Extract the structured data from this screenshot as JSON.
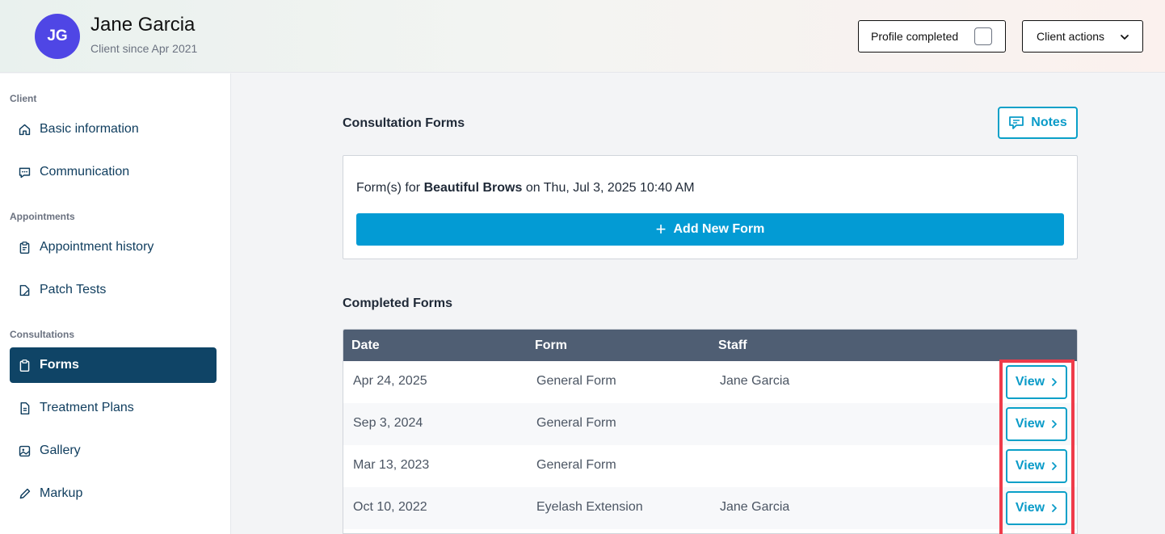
{
  "header": {
    "initials": "JG",
    "name": "Jane Garcia",
    "since": "Client since Apr 2021",
    "profile_completed_label": "Profile completed",
    "client_actions_label": "Client actions"
  },
  "sidebar": {
    "sections": [
      {
        "title": "Client",
        "items": [
          {
            "label": "Basic information",
            "icon": "home-icon"
          },
          {
            "label": "Communication",
            "icon": "chat-icon"
          }
        ]
      },
      {
        "title": "Appointments",
        "items": [
          {
            "label": "Appointment history",
            "icon": "clipboard-list-icon"
          },
          {
            "label": "Patch Tests",
            "icon": "patch-icon"
          }
        ]
      },
      {
        "title": "Consultations",
        "items": [
          {
            "label": "Forms",
            "icon": "clipboard-icon",
            "active": true
          },
          {
            "label": "Treatment Plans",
            "icon": "document-icon"
          },
          {
            "label": "Gallery",
            "icon": "image-icon"
          },
          {
            "label": "Markup",
            "icon": "pencil-icon"
          }
        ]
      }
    ]
  },
  "main": {
    "consultation_title": "Consultation Forms",
    "notes_label": "Notes",
    "form_card": {
      "prefix": "Form(s) for",
      "service": "Beautiful Brows",
      "suffix": "on Thu, Jul 3, 2025 10:40 AM",
      "add_label": "Add New Form"
    },
    "completed_title": "Completed Forms",
    "table": {
      "headers": [
        "Date",
        "Form",
        "Staff"
      ],
      "view_label": "View",
      "rows": [
        {
          "date": "Apr 24, 2025",
          "form": "General Form",
          "staff": "Jane Garcia"
        },
        {
          "date": "Sep 3, 2024",
          "form": "General Form",
          "staff": ""
        },
        {
          "date": "Mar 13, 2023",
          "form": "General Form",
          "staff": ""
        },
        {
          "date": "Oct 10, 2022",
          "form": "Eyelash Extension",
          "staff": "Jane Garcia"
        }
      ]
    }
  },
  "colors": {
    "accent": "#039bd4",
    "sidebar_active": "#0f4466",
    "table_header": "#4f5e73",
    "avatar": "#4f46e5",
    "highlight": "#ef3b4a"
  }
}
